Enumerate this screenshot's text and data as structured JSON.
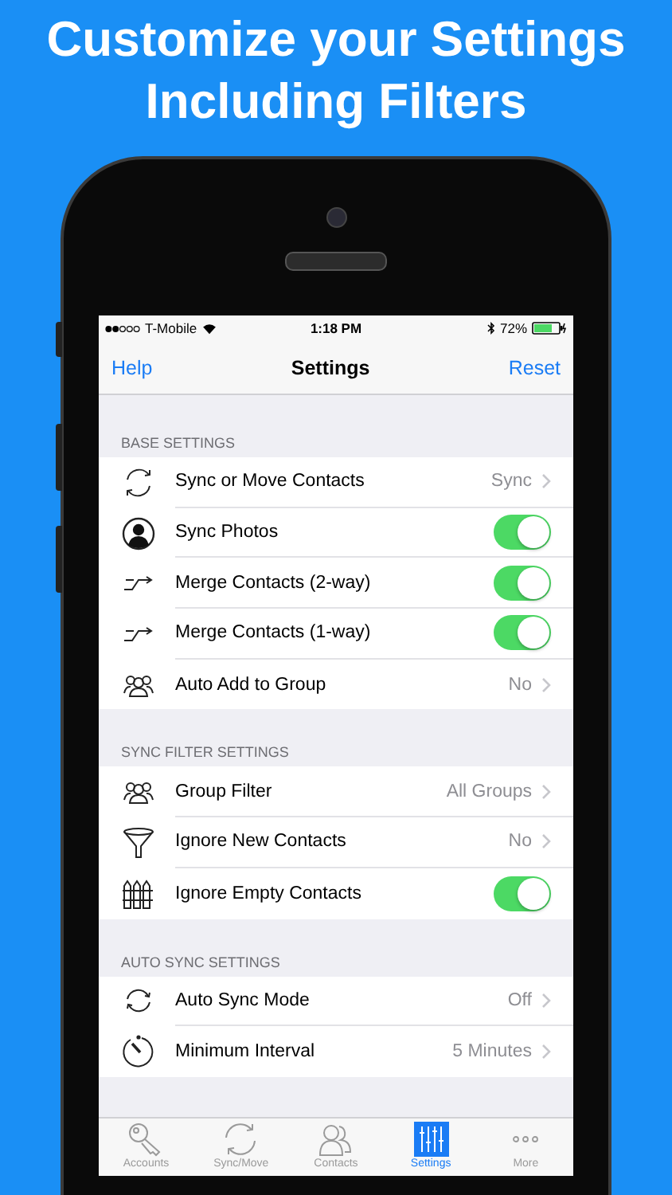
{
  "headline": [
    "Customize your Settings",
    "Including Filters"
  ],
  "status_bar": {
    "carrier": "T-Mobile",
    "time": "1:18 PM",
    "battery": "72%"
  },
  "nav": {
    "left": "Help",
    "title": "Settings",
    "right": "Reset"
  },
  "sections": [
    {
      "header": "BASE SETTINGS",
      "rows": [
        {
          "label": "Sync or Move Contacts",
          "kind": "value",
          "value": "Sync"
        },
        {
          "label": "Sync Photos",
          "kind": "toggle",
          "on": true
        },
        {
          "label": "Merge Contacts (2-way)",
          "kind": "toggle",
          "on": true
        },
        {
          "label": "Merge Contacts (1-way)",
          "kind": "toggle",
          "on": true
        },
        {
          "label": "Auto Add to Group",
          "kind": "value",
          "value": "No"
        }
      ]
    },
    {
      "header": "SYNC FILTER SETTINGS",
      "rows": [
        {
          "label": "Group Filter",
          "kind": "value",
          "value": "All Groups"
        },
        {
          "label": "Ignore New Contacts",
          "kind": "value",
          "value": "No"
        },
        {
          "label": "Ignore Empty Contacts",
          "kind": "toggle",
          "on": true
        }
      ]
    },
    {
      "header": "AUTO SYNC SETTINGS",
      "rows": [
        {
          "label": "Auto Sync Mode",
          "kind": "value",
          "value": "Off"
        },
        {
          "label": "Minimum Interval",
          "kind": "value",
          "value": "5 Minutes"
        }
      ]
    }
  ],
  "tabs": [
    {
      "label": "Accounts",
      "selected": false
    },
    {
      "label": "Sync/Move",
      "selected": false
    },
    {
      "label": "Contacts",
      "selected": false
    },
    {
      "label": "Settings",
      "selected": true
    },
    {
      "label": "More",
      "selected": false
    }
  ]
}
